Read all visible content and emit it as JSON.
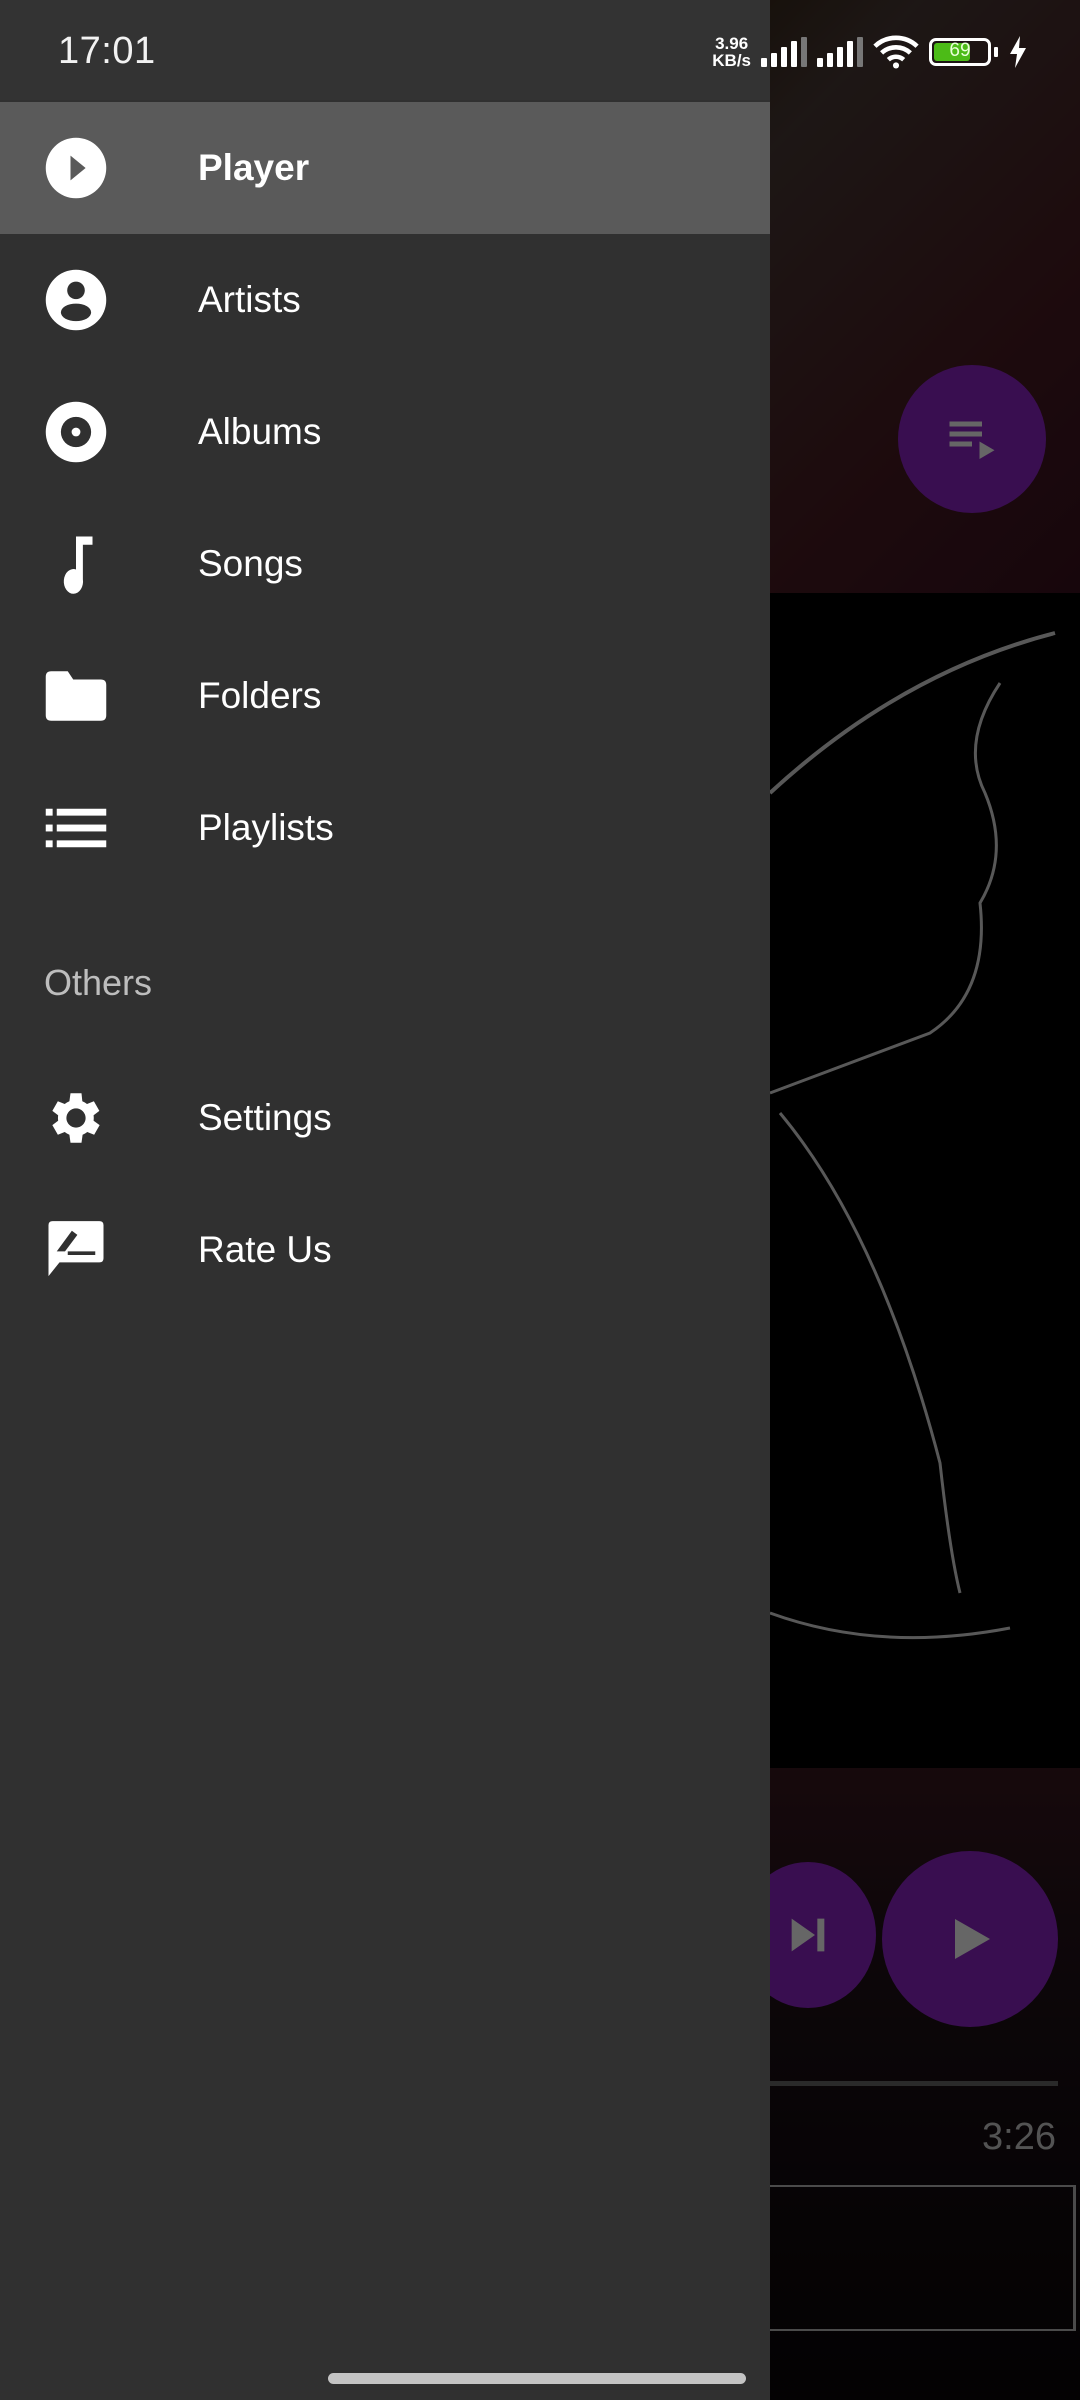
{
  "status_bar": {
    "time": "17:01",
    "net_speed_value": "3.96",
    "net_speed_unit": "KB/s",
    "battery_level": "69",
    "battery_fraction": 0.69,
    "charging": true,
    "icons": [
      "signal-icon",
      "signal-icon",
      "wifi-icon",
      "battery-icon",
      "charging-bolt-icon"
    ]
  },
  "drawer": {
    "main_items": [
      {
        "label": "Player",
        "icon": "play-circle-icon",
        "selected": true
      },
      {
        "label": "Artists",
        "icon": "account-circle-icon",
        "selected": false
      },
      {
        "label": "Albums",
        "icon": "album-icon",
        "selected": false
      },
      {
        "label": "Songs",
        "icon": "music-note-icon",
        "selected": false
      },
      {
        "label": "Folders",
        "icon": "folder-icon",
        "selected": false
      },
      {
        "label": "Playlists",
        "icon": "list-icon",
        "selected": false
      }
    ],
    "section_header": "Others",
    "other_items": [
      {
        "label": "Settings",
        "icon": "settings-gear-icon"
      },
      {
        "label": "Rate Us",
        "icon": "rate-review-icon"
      }
    ]
  },
  "player_background": {
    "total_time": "3:26",
    "accent_color": "#8e24c8",
    "buttons": [
      "queue-icon",
      "skip-next-icon",
      "play-icon"
    ]
  },
  "colors": {
    "drawer_bg": "#303030",
    "selected_bg": "#5a5a5a",
    "text": "#ffffff",
    "section_header": "#bdbdbd"
  }
}
